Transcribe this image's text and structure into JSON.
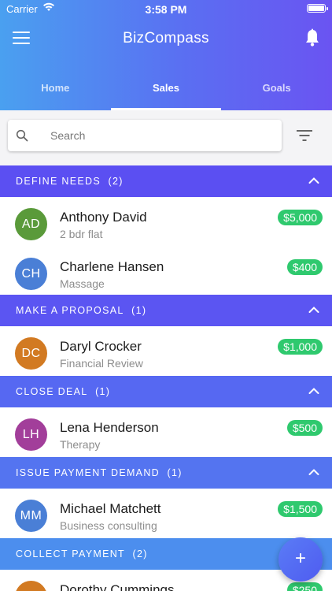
{
  "status_bar": {
    "carrier": "Carrier",
    "time": "3:58 PM"
  },
  "header": {
    "title": "BizCompass",
    "menu_icon": "hamburger-menu-icon",
    "notification_icon": "bell-icon"
  },
  "tabs": [
    {
      "label": "Home",
      "active": false
    },
    {
      "label": "Sales",
      "active": true
    },
    {
      "label": "Goals",
      "active": false
    }
  ],
  "search": {
    "placeholder": "Search",
    "value": ""
  },
  "colors": {
    "header_gradient_start": "#4aa0f0",
    "header_gradient_end": "#6a54f2",
    "amount_badge": "#2fc96e",
    "section_define_needs": "#5b4ff2",
    "section_make_proposal": "#5b55f2",
    "section_close_deal": "#5668f2",
    "section_issue_payment": "#5474f0",
    "section_collect_payment": "#4c8eee"
  },
  "sections": [
    {
      "title": "DEFINE NEEDS",
      "count": "(2)",
      "items": [
        {
          "initials": "AD",
          "name": "Anthony David",
          "desc": "2 bdr flat",
          "amount": "$5,000",
          "avatar_color": "#5a9a3a"
        },
        {
          "initials": "CH",
          "name": "Charlene Hansen",
          "desc": "Massage",
          "amount": "$400",
          "avatar_color": "#4a7fd6"
        }
      ]
    },
    {
      "title": "MAKE A PROPOSAL",
      "count": "(1)",
      "items": [
        {
          "initials": "DC",
          "name": "Daryl Crocker",
          "desc": "Financial Review",
          "amount": "$1,000",
          "avatar_color": "#d27a22"
        }
      ]
    },
    {
      "title": "CLOSE DEAL",
      "count": "(1)",
      "items": [
        {
          "initials": "LH",
          "name": "Lena Henderson",
          "desc": "Therapy",
          "amount": "$500",
          "avatar_color": "#a23e9a"
        }
      ]
    },
    {
      "title": "ISSUE PAYMENT DEMAND",
      "count": "(1)",
      "items": [
        {
          "initials": "MM",
          "name": "Michael Matchett",
          "desc": "Business consulting",
          "amount": "$1,500",
          "avatar_color": "#4a7fd6"
        }
      ]
    },
    {
      "title": "COLLECT PAYMENT",
      "count": "(2)",
      "items": [
        {
          "initials": "DC",
          "name": "Dorothy Cummings",
          "desc": "",
          "amount": "$250",
          "avatar_color": "#d27a22"
        }
      ]
    }
  ],
  "fab": {
    "label": "+",
    "icon": "plus-icon"
  }
}
